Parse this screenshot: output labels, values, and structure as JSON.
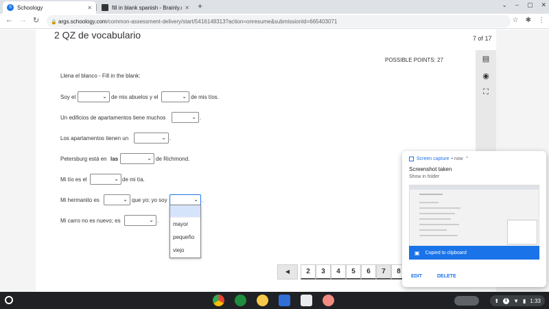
{
  "browser": {
    "tabs": [
      {
        "title": "Schoology",
        "favicon_letter": "S",
        "favicon_color": "#1a73e8"
      },
      {
        "title": "fill in blank spanish - Brainly.com",
        "favicon_color": "#333333"
      }
    ],
    "new_tab": "+",
    "url_host": "args.schoology.com",
    "url_rest": "/common-assessment-delivery/start/5416148313?action=onresume&submissionId=665403071"
  },
  "page": {
    "title": "2 QZ de vocabulario",
    "page_indicator": "7 of 17",
    "possible_points": "POSSIBLE POINTS: 27",
    "instructions": "Llena el blanco - Fill in the blank:",
    "q1": {
      "before": "Soy el",
      "middle": "de mis abuelos y el",
      "after": "de mis tíos."
    },
    "q2": {
      "before": "Un edificios de apartamentos tiene muchos",
      "after": "."
    },
    "q3": {
      "before": "Los apartamentos tienen un",
      "after": "."
    },
    "q4": {
      "before": "Petersburg está en",
      "bold": "las",
      "after": "de Richmond."
    },
    "q5": {
      "before": "Mi tío es el",
      "after": "de mi tía."
    },
    "q6": {
      "before": "Mi hermanito es",
      "middle": "que yo; yo soy",
      "after": "."
    },
    "q7": {
      "before": "Mi carro no es nuevo; es",
      "after": "."
    },
    "dropdown_options": [
      "mayor",
      "pequeño",
      "viejo"
    ]
  },
  "pagination": {
    "prev": "◀",
    "pages": [
      "2",
      "3",
      "4",
      "5",
      "6",
      "7",
      "8"
    ],
    "active": "7"
  },
  "notification": {
    "source": "Screen capture",
    "time": "• now",
    "title": "Screenshot taken",
    "subtitle": "Show in folder",
    "clipboard": "Copied to clipboard",
    "edit": "EDIT",
    "delete": "DELETE"
  },
  "shelf": {
    "notification_count": "1",
    "time": "1:33"
  }
}
